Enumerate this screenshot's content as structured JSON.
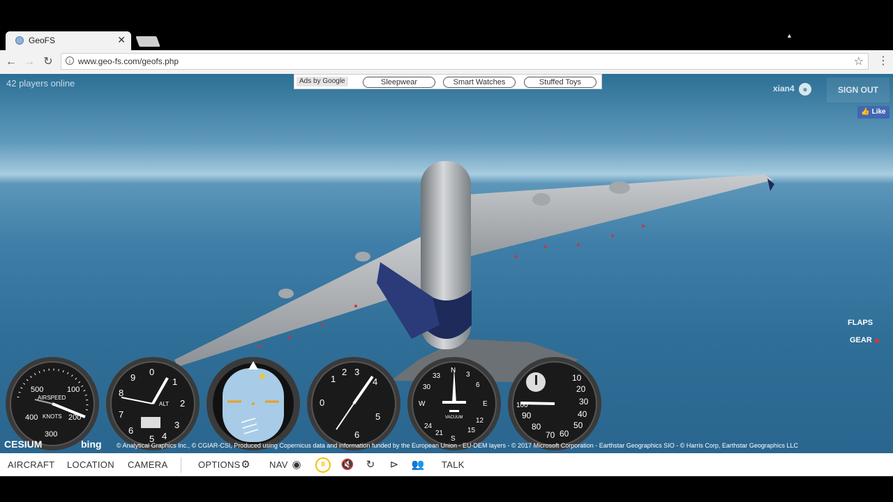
{
  "browser": {
    "tab_title": "GeoFS",
    "url": "www.geo-fs.com/geofs.php",
    "back_icon": "back-arrow-icon",
    "forward_icon": "forward-arrow-icon",
    "reload_icon": "reload-icon"
  },
  "game": {
    "players_online": "42 players online",
    "ads": {
      "label": "Ads by Google",
      "buttons": [
        "Sleepwear",
        "Smart Watches",
        "Stuffed Toys"
      ]
    },
    "user": {
      "name": "xian4",
      "signout": "SIGN OUT"
    },
    "like": "Like",
    "flaps_label": "FLAPS",
    "gear_label": "GEAR",
    "gauges": {
      "airspeed": {
        "label": "AIRSPEED",
        "unit": "KNOTS",
        "ticks": [
          "500",
          "100",
          "400",
          "200",
          "300"
        ]
      },
      "altimeter": {
        "label": "ALT",
        "ticks": [
          "0",
          "1",
          "2",
          "3",
          "4",
          "5",
          "6",
          "7",
          "8",
          "9"
        ]
      },
      "turn": {
        "ticks": [
          "1",
          "2",
          "3",
          "4",
          "5",
          "6",
          "0"
        ]
      },
      "heading": {
        "ticks": [
          "N",
          "3",
          "6",
          "E",
          "12",
          "15",
          "S",
          "21",
          "24",
          "W",
          "30",
          "33"
        ],
        "label": "VACUUM"
      },
      "vsi": {
        "ticks": [
          "10",
          "20",
          "30",
          "40",
          "50",
          "60",
          "70",
          "80",
          "90",
          "100"
        ]
      }
    },
    "credits": {
      "cesium": "CESIUM",
      "bing": "bing",
      "text": "© Analytical Graphics Inc., © CGIAR-CSI, Produced using Copernicus data and information funded by the European Union - EU-DEM layers - © 2017 Microsoft Corporation - Earthstar Geographics SIO - © Harris Corp, Earthstar Geographics LLC"
    }
  },
  "bottombar": {
    "aircraft": "AIRCRAFT",
    "location": "LOCATION",
    "camera": "CAMERA",
    "options": "OPTIONS",
    "nav": "NAV",
    "talk": "TALK"
  },
  "colors": {
    "accent_pause": "#f2c200",
    "gear_light": "#e0322d",
    "fb": "#4267b2"
  }
}
